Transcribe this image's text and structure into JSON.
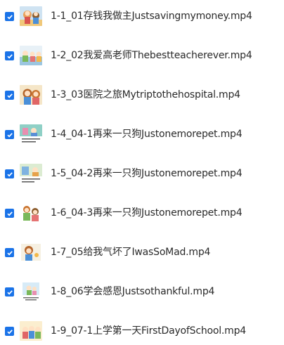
{
  "files": [
    {
      "name": "1-1_01存钱我做主Justsavingmymoney.mp4",
      "checked": true,
      "thumb_icon": "cartoon-book-cover-thumbnail"
    },
    {
      "name": "1-2_02我爱高老师Thebestteacherever.mp4",
      "checked": true,
      "thumb_icon": "cartoon-book-cover-thumbnail"
    },
    {
      "name": "1-3_03医院之旅Mytriptothehospital.mp4",
      "checked": true,
      "thumb_icon": "cartoon-book-cover-thumbnail"
    },
    {
      "name": "1-4_04-1再来一只狗Justonemorepet.mp4",
      "checked": true,
      "thumb_icon": "cartoon-book-page-thumbnail"
    },
    {
      "name": "1-5_04-2再来一只狗Justonemorepet.mp4",
      "checked": true,
      "thumb_icon": "cartoon-book-page-thumbnail"
    },
    {
      "name": "1-6_04-3再来一只狗Justonemorepet.mp4",
      "checked": true,
      "thumb_icon": "cartoon-book-cover-thumbnail"
    },
    {
      "name": "1-7_05给我气坏了IwasSoMad.mp4",
      "checked": true,
      "thumb_icon": "cartoon-book-cover-thumbnail"
    },
    {
      "name": "1-8_06学会感恩Justsothankful.mp4",
      "checked": true,
      "thumb_icon": "cartoon-book-page-thumbnail"
    },
    {
      "name": "1-9_07-1上学第一天FirstDayofSchool.mp4",
      "checked": true,
      "thumb_icon": "cartoon-book-cover-thumbnail"
    }
  ],
  "colors": {
    "checkbox": "#1a73e8",
    "text": "#2a2a2a"
  }
}
